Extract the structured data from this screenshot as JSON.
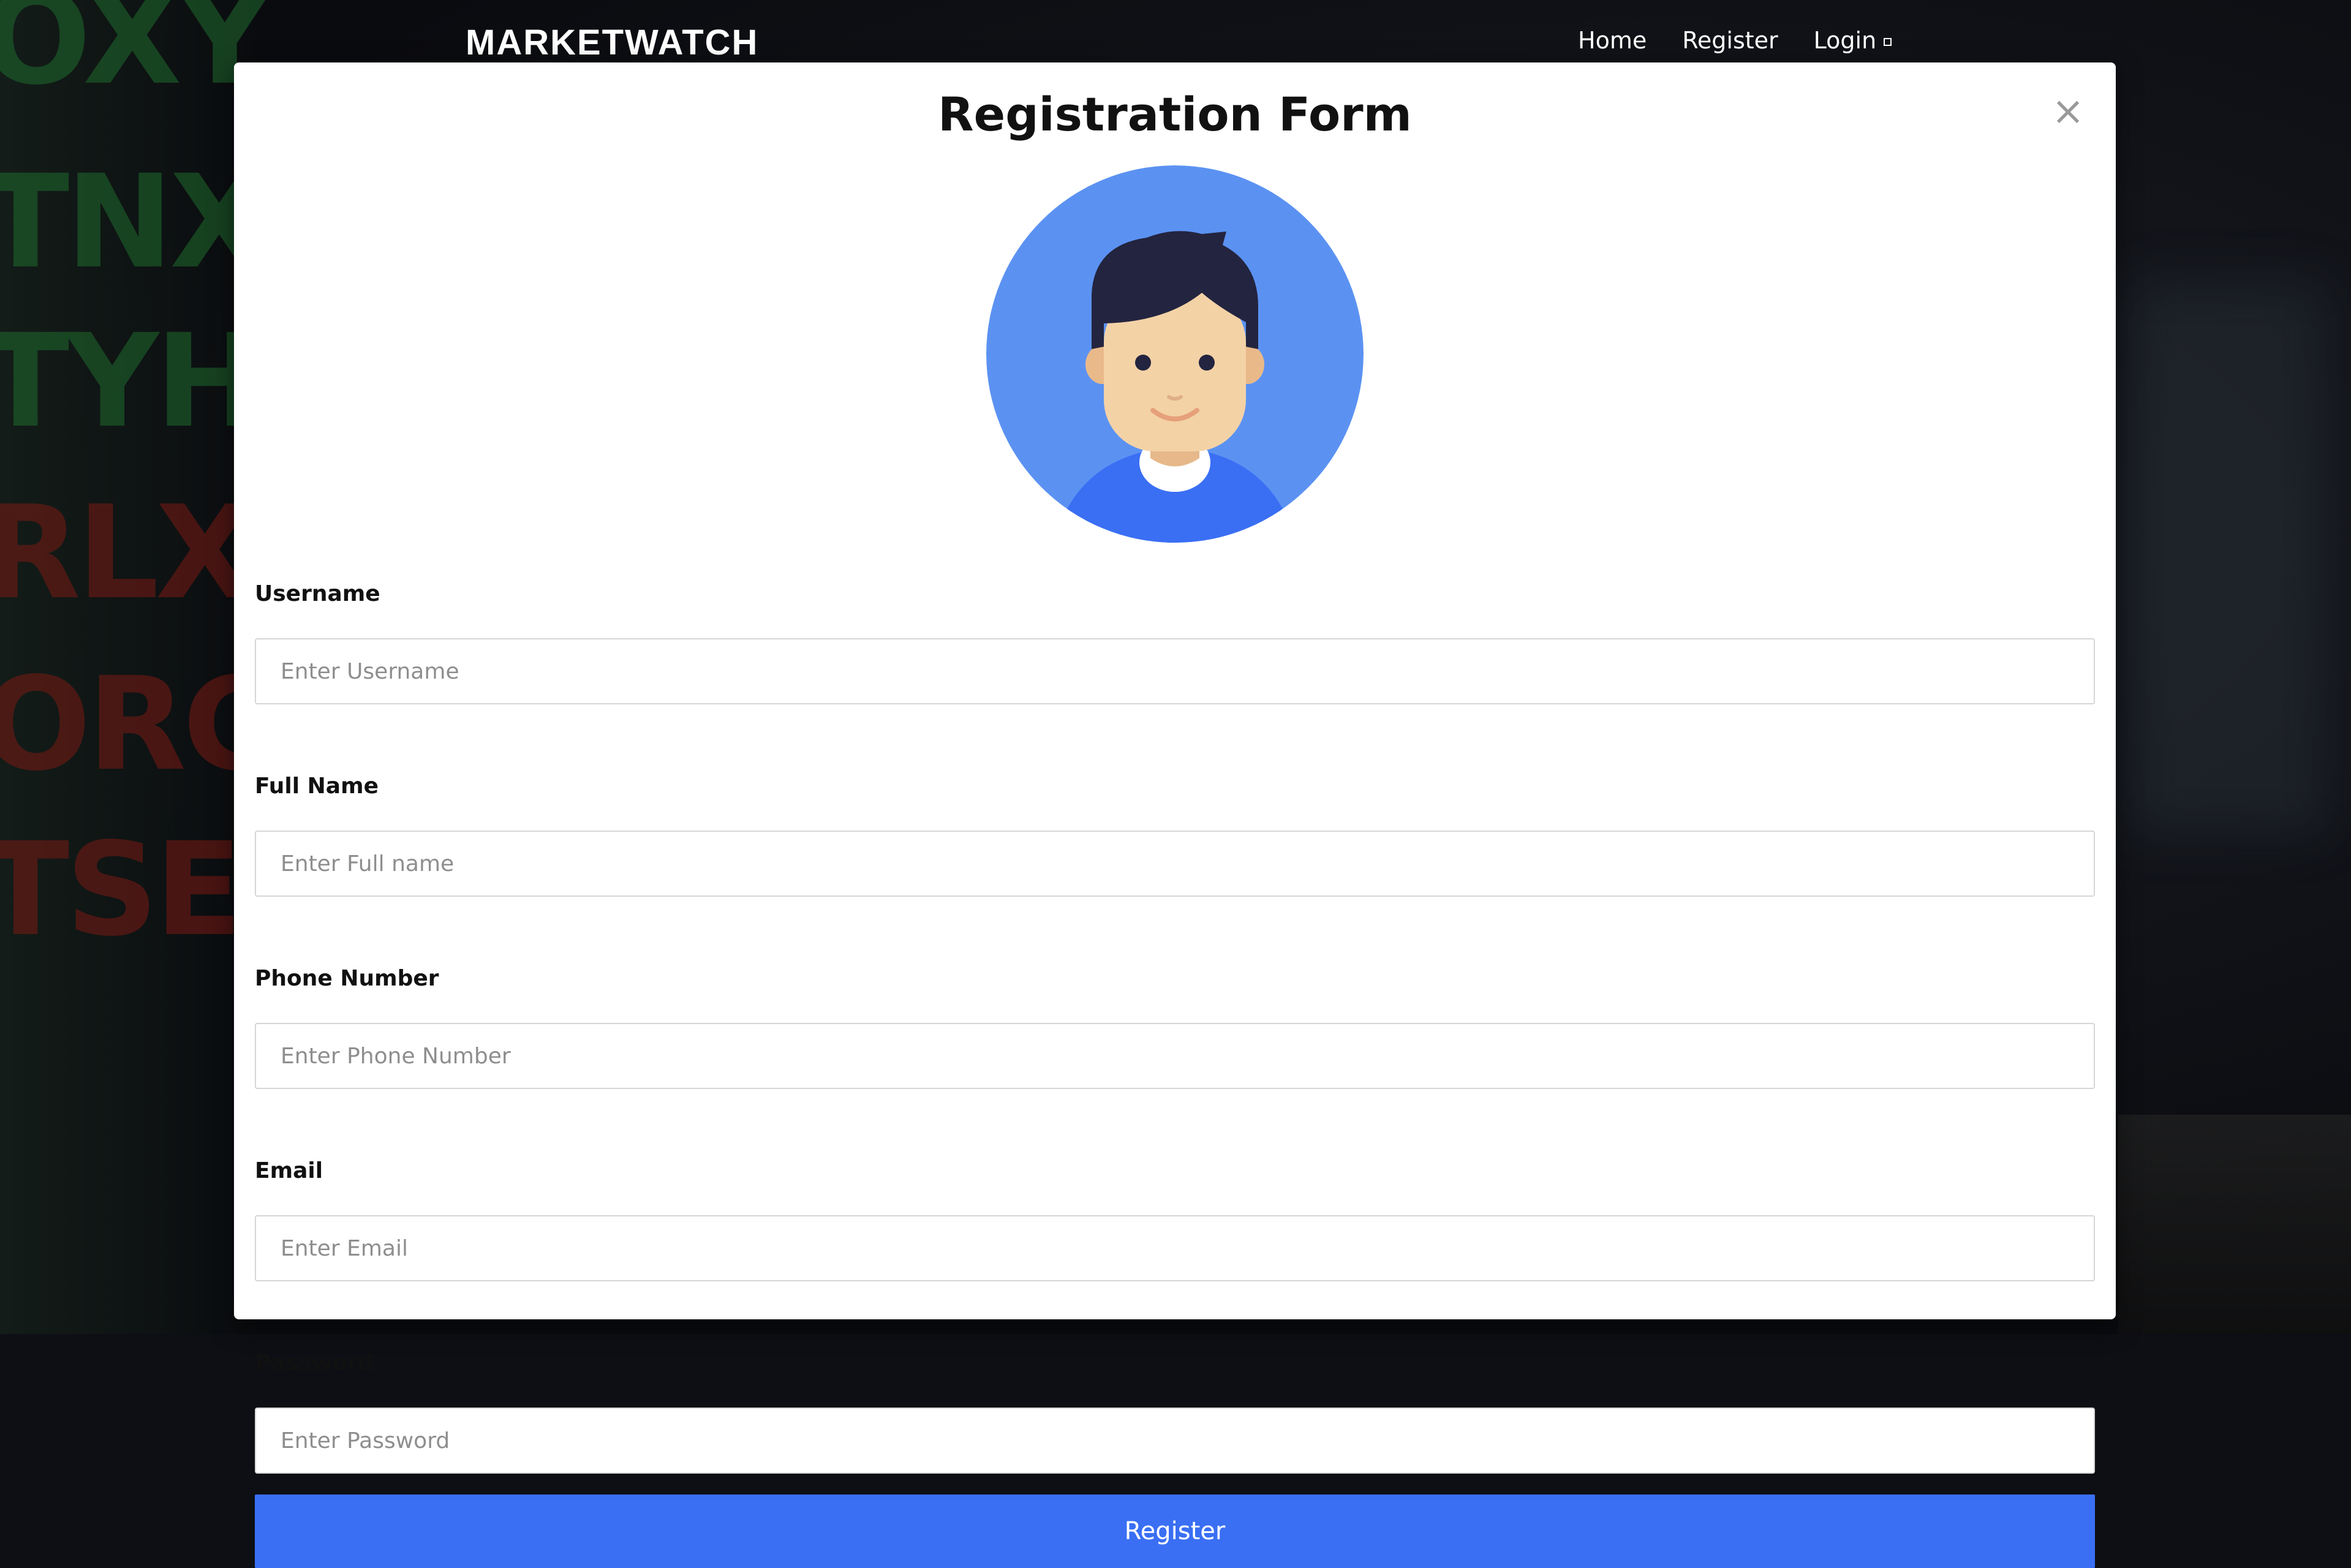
{
  "background": {
    "tickers": [
      "OXY",
      "TNX",
      "TYH",
      "RLX",
      "ORG",
      "TSE"
    ]
  },
  "nav": {
    "brand": "MARKETWATCH",
    "links": [
      "Home",
      "Register",
      "Login"
    ]
  },
  "modal": {
    "title": "Registration Form",
    "close_label": "×"
  },
  "form": {
    "fields": [
      {
        "label": "Username",
        "placeholder": "Enter Username",
        "value": ""
      },
      {
        "label": "Full Name",
        "placeholder": "Enter Full name",
        "value": ""
      },
      {
        "label": "Phone Number",
        "placeholder": "Enter Phone Number",
        "value": ""
      },
      {
        "label": "Email",
        "placeholder": "Enter Email",
        "value": ""
      },
      {
        "label": "Password",
        "placeholder": "Enter Password",
        "value": ""
      }
    ],
    "submit_label": "Register"
  },
  "colors": {
    "accent": "#3a6ff4",
    "avatar_bg": "#5b92f2",
    "shirt": "#3a6ff4",
    "hair": "#23243f",
    "skin": "#f3d2a6"
  }
}
